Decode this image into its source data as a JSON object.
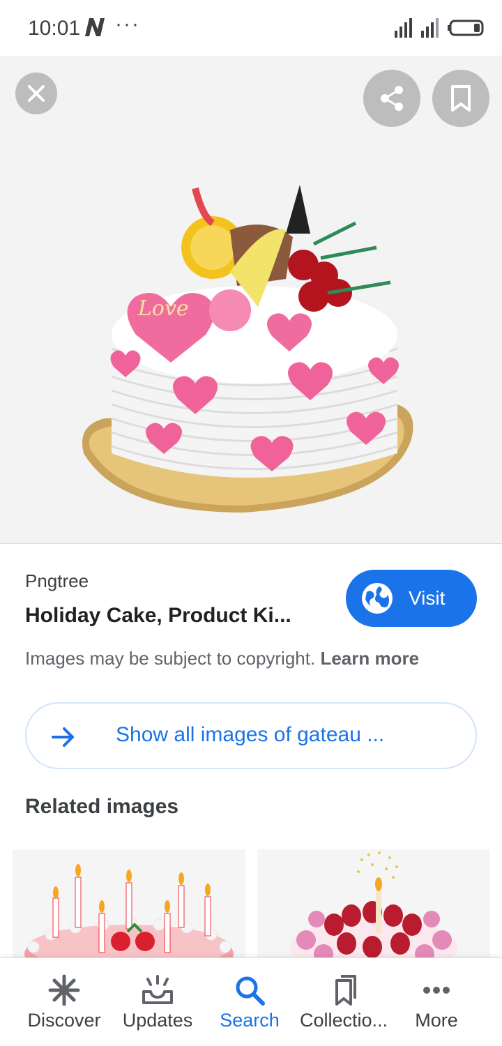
{
  "status_bar": {
    "time": "10:01",
    "dots": "···"
  },
  "viewer": {
    "image_alt": "Heart decorated cake with Love topper",
    "cake_topper_text": "Love"
  },
  "result": {
    "source": "Pngtree",
    "title": "Holiday Cake, Product Ki...",
    "visit_label": "Visit",
    "copyright_text": "Images may be subject to copyright.",
    "learn_more": "Learn more",
    "show_all_label": "Show all images of gateau ..."
  },
  "related": {
    "title": "Related images"
  },
  "bottom_nav": {
    "items": [
      {
        "label": "Discover",
        "icon": "asterisk-icon"
      },
      {
        "label": "Updates",
        "icon": "inbox-icon"
      },
      {
        "label": "Search",
        "icon": "search-icon"
      },
      {
        "label": "Collectio...",
        "icon": "collections-icon"
      },
      {
        "label": "More",
        "icon": "more-dots-icon"
      }
    ],
    "active": "Search"
  },
  "colors": {
    "accent": "#1a73e8",
    "viewer_bg": "#f3f3f3",
    "overlay_button": "#bdbdbd"
  }
}
